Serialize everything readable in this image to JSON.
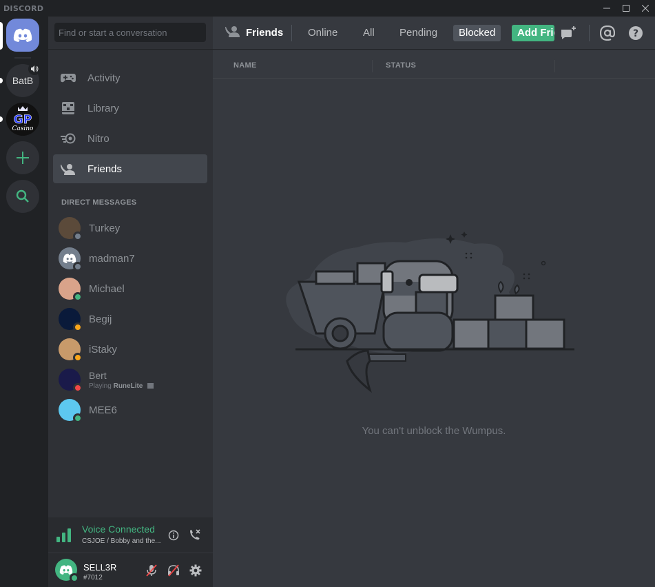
{
  "app": {
    "brand": "DISCORD"
  },
  "servers": [
    {
      "name": "home",
      "label": ""
    },
    {
      "name": "BatB",
      "label": "BatB"
    },
    {
      "name": "GP Casino",
      "label": "GP Casino"
    }
  ],
  "search": {
    "placeholder": "Find or start a conversation"
  },
  "nav": {
    "activity": "Activity",
    "library": "Library",
    "nitro": "Nitro",
    "friends": "Friends"
  },
  "dm_header": "DIRECT MESSAGES",
  "dms": [
    {
      "name": "Turkey",
      "status": "offline",
      "avatar_color": "#5b4a3a"
    },
    {
      "name": "madman7",
      "status": "offline",
      "avatar_color": "#747f8d"
    },
    {
      "name": "Michael",
      "status": "online",
      "avatar_color": "#d9a38a"
    },
    {
      "name": "Begij",
      "status": "idle",
      "avatar_color": "#0a1a3a"
    },
    {
      "name": "iStaky",
      "status": "idle",
      "avatar_color": "#c89a6a"
    },
    {
      "name": "Bert",
      "status": "dnd",
      "avatar_color": "#1a1a4a",
      "activity_prefix": "Playing",
      "activity_game": "RuneLite"
    },
    {
      "name": "MEE6",
      "status": "online",
      "avatar_color": "#5dc8f0"
    }
  ],
  "voice": {
    "title": "Voice Connected",
    "channel": "CSJOE / Bobby and the..."
  },
  "user": {
    "name": "SELL3R",
    "tag": "#7012"
  },
  "header": {
    "title": "Friends",
    "tabs": [
      "Online",
      "All",
      "Pending",
      "Blocked"
    ],
    "active_tab": "Blocked",
    "add_friend": "Add Friend"
  },
  "columns": {
    "name": "NAME",
    "status": "STATUS"
  },
  "empty_state": {
    "text": "You can't unblock the Wumpus."
  },
  "colors": {
    "accent": "#7289da",
    "online": "#43b581",
    "idle": "#faa61a",
    "dnd": "#f04747",
    "offline": "#747f8d"
  }
}
